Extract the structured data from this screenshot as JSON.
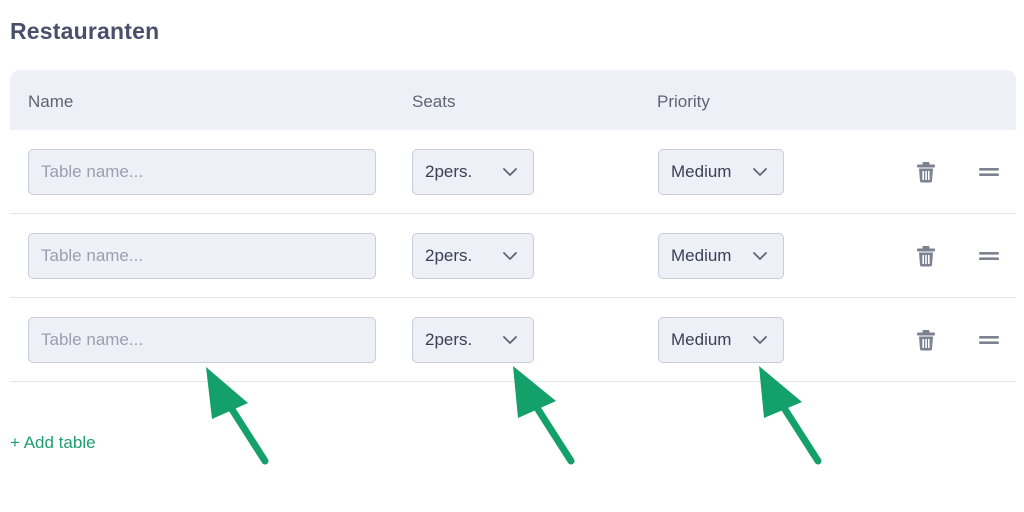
{
  "page": {
    "title": "Restauranten"
  },
  "table": {
    "headers": {
      "name": "Name",
      "seats": "Seats",
      "priority": "Priority"
    },
    "rows": [
      {
        "name_placeholder": "Table name...",
        "name_value": "",
        "seats": "2pers.",
        "priority": "Medium"
      },
      {
        "name_placeholder": "Table name...",
        "name_value": "",
        "seats": "2pers.",
        "priority": "Medium"
      },
      {
        "name_placeholder": "Table name...",
        "name_value": "",
        "seats": "2pers.",
        "priority": "Medium"
      }
    ]
  },
  "actions": {
    "add_table": "+ Add table"
  },
  "icons": {
    "chevron": "chevron-down-icon",
    "trash": "trash-icon",
    "drag": "drag-handle-icon",
    "arrow": "arrow-up-left-icon"
  },
  "colors": {
    "accent_green": "#14a06a",
    "field_bg": "#eef0f8",
    "field_border": "#c9ccda",
    "title": "#4a4f6a",
    "icon_gray": "#7d8292"
  }
}
